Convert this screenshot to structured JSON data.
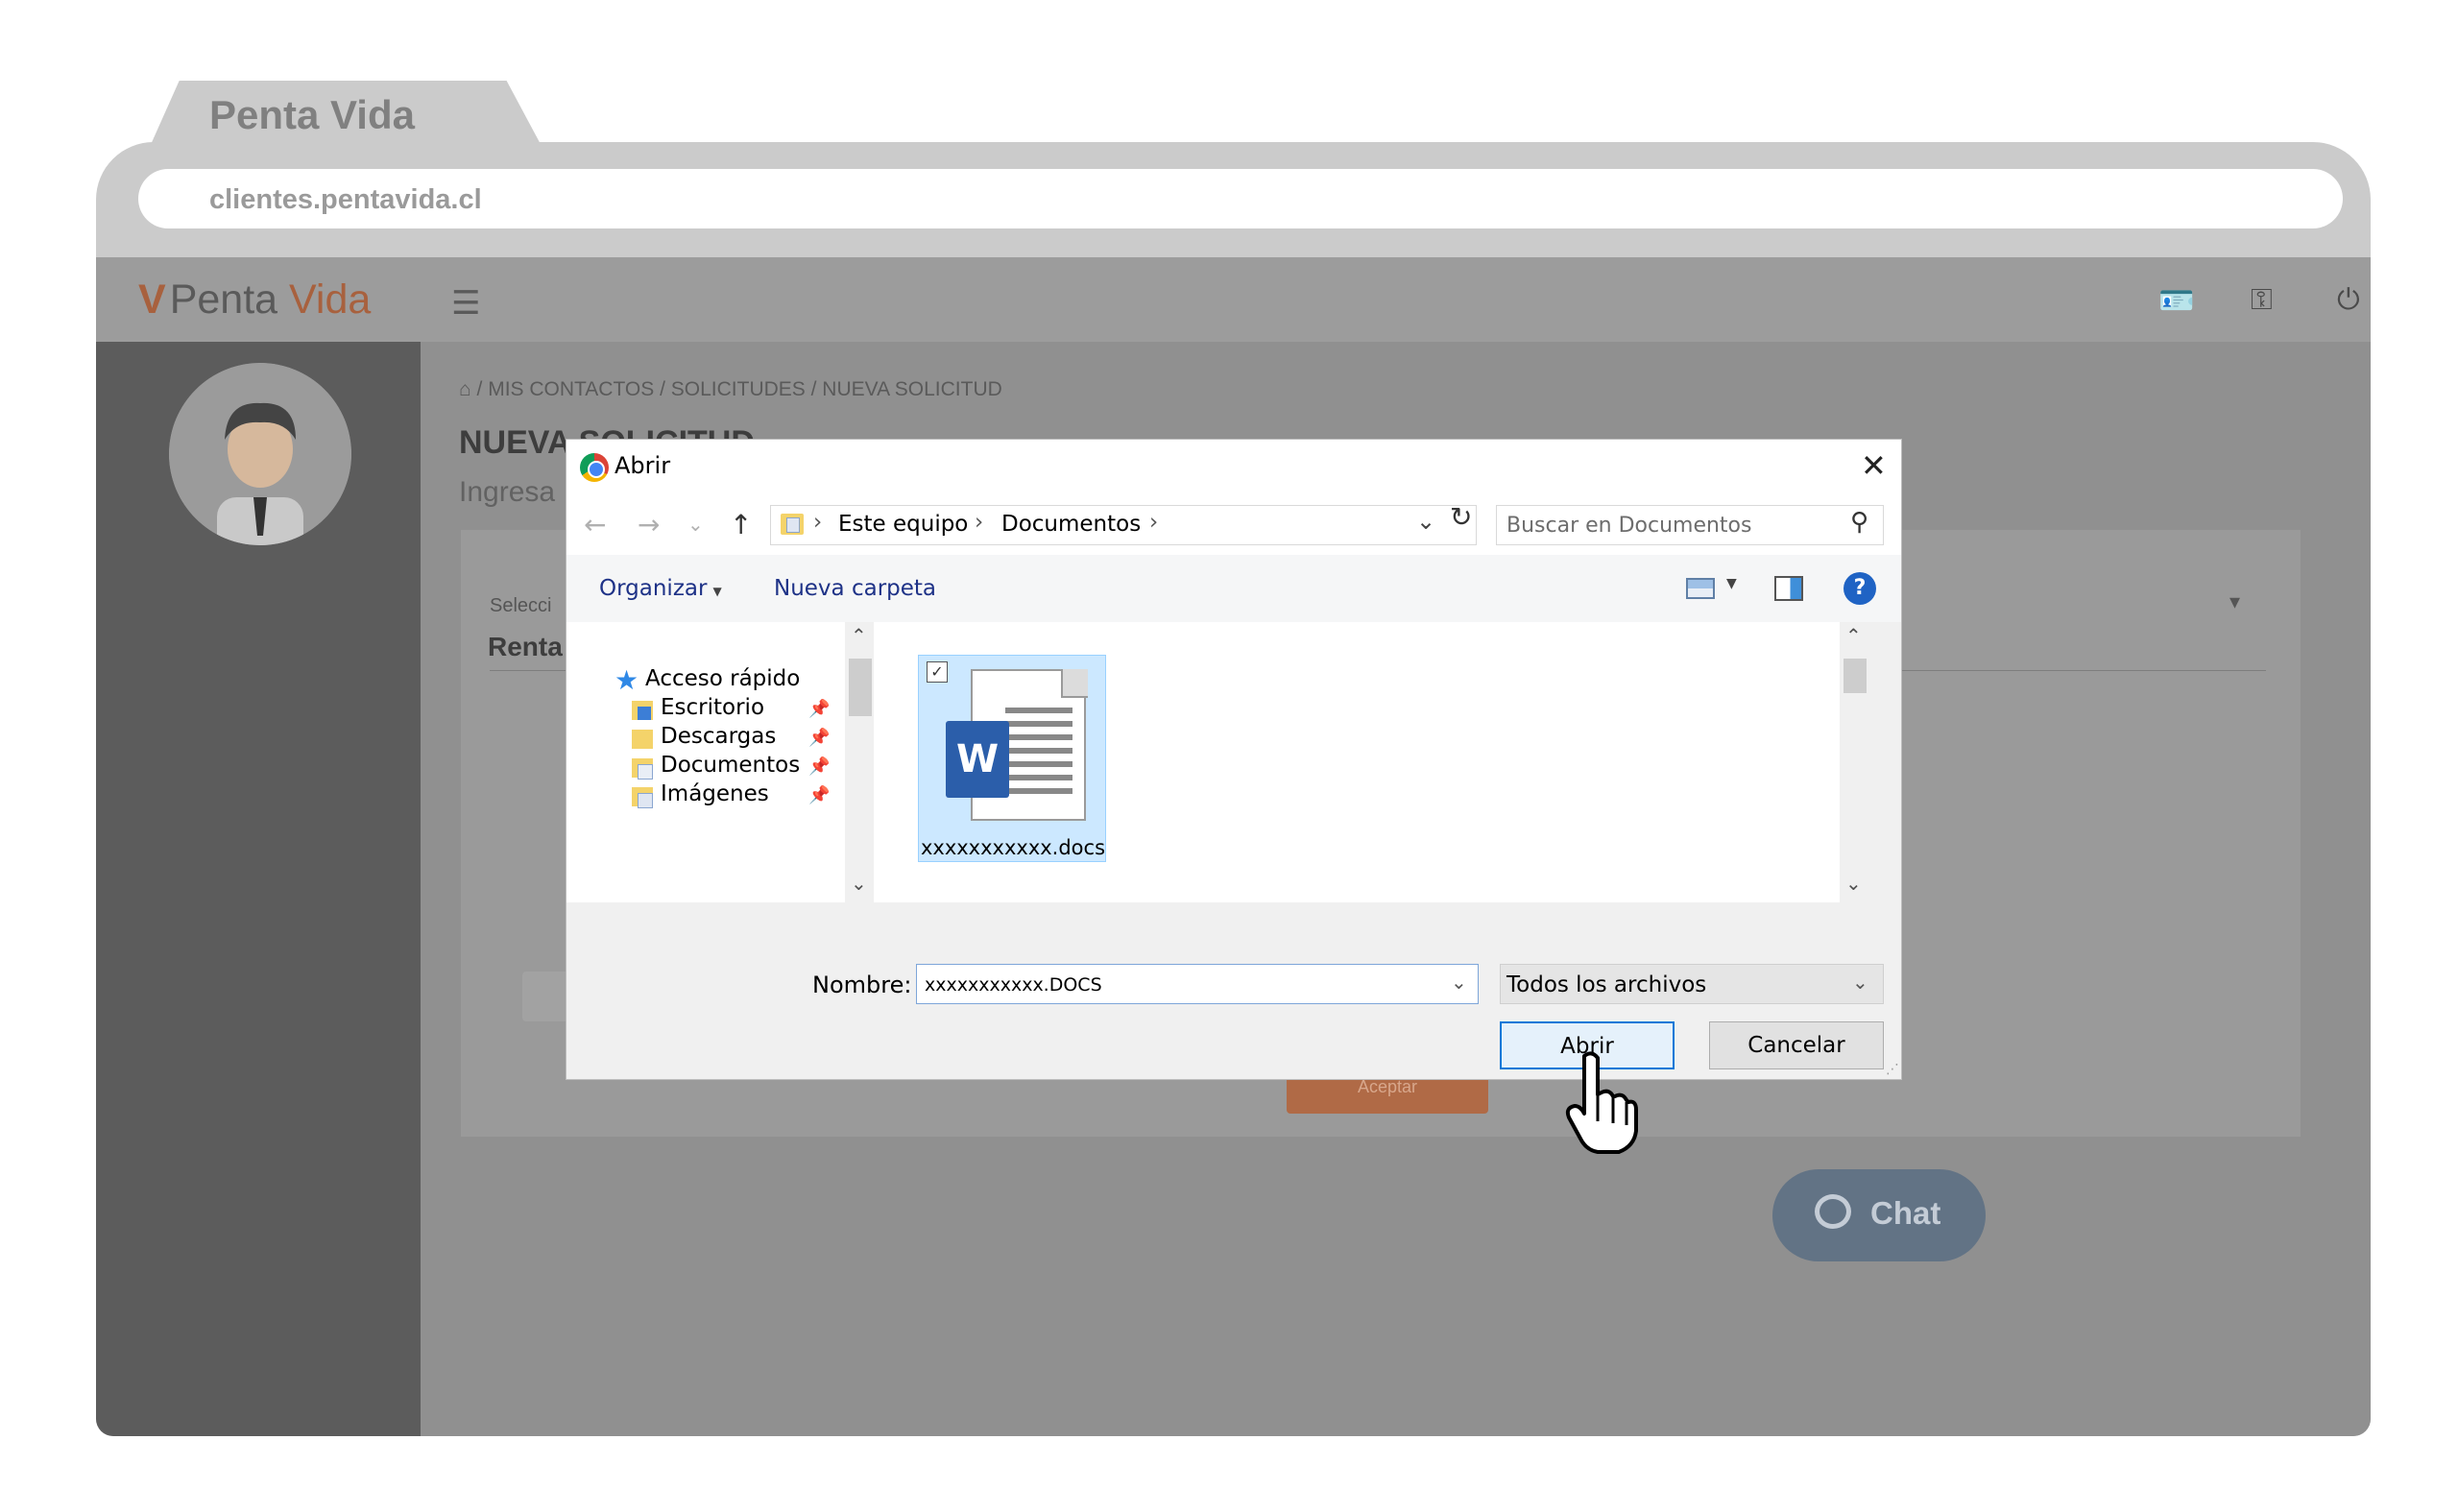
{
  "browser": {
    "tab_title": "Penta Vida",
    "url": "clientes.pentavida.cl"
  },
  "app": {
    "logo": {
      "part1": "Penta",
      "part2": "Vida"
    },
    "breadcrumb": "/ MIS CONTACTOS / SOLICITUDES / NUEVA SOLICITUD",
    "page_title": "NUEVA SOLICITUD",
    "page_subtitle": "Ingresa",
    "card": {
      "select_label": "Selecci",
      "select_value": "Renta",
      "accept_label": "Aceptar"
    },
    "chat_label": "Chat",
    "icons": [
      "menu-icon",
      "id-card-icon",
      "key-icon",
      "power-icon",
      "home-icon",
      "chat-bubble-icon"
    ]
  },
  "dialog": {
    "title": "Abrir",
    "path": [
      "Este equipo",
      "Documentos"
    ],
    "search_placeholder": "Buscar en Documentos",
    "toolbar": {
      "organize": "Organizar",
      "new_folder": "Nueva carpeta"
    },
    "quick_access": "Acceso rápido",
    "nav_items": [
      "Escritorio",
      "Descargas",
      "Documentos",
      "Imágenes"
    ],
    "file": {
      "name": "xxxxxxxxxxx.docs",
      "icon_letter": "W"
    },
    "name_label": "Nombre:",
    "name_value": "xxxxxxxxxxx.DOCS",
    "filter_value": "Todos los archivos",
    "open_button": "Abrir",
    "cancel_button": "Cancelar"
  },
  "colors": {
    "accent": "#a8613e",
    "chat": "#627385",
    "dialog_selection": "#cce8ff",
    "primary_button_border": "#0078d7"
  }
}
